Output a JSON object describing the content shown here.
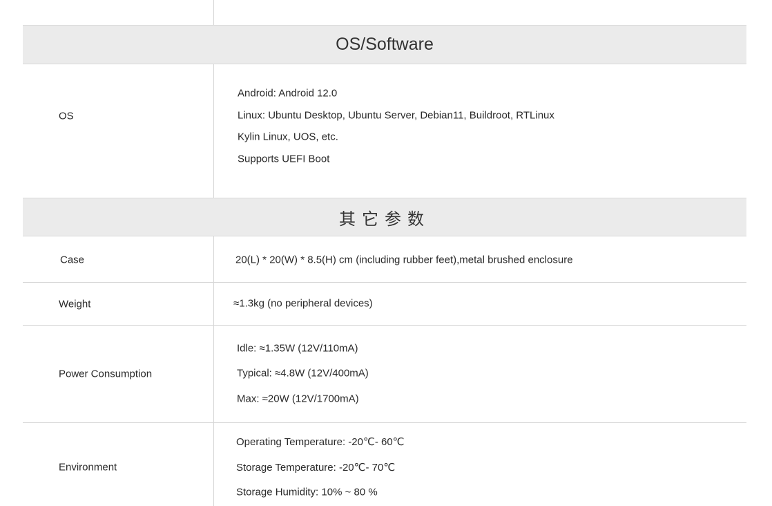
{
  "sections": [
    {
      "title": "OS/Software",
      "rows": [
        {
          "label": "OS",
          "values": [
            "Android: Android 12.0",
            "Linux: Ubuntu Desktop, Ubuntu Server, Debian11, Buildroot, RTLinux",
            "Kylin Linux, UOS, etc.",
            "Supports UEFI Boot"
          ]
        }
      ]
    },
    {
      "title": "其它参数",
      "rows": [
        {
          "label": "Case",
          "values": [
            "20(L) * 20(W) * 8.5(H) cm (including rubber feet),metal brushed enclosure"
          ]
        },
        {
          "label": "Weight",
          "values": [
            "≈1.3kg (no peripheral devices)"
          ]
        },
        {
          "label": "Power Consumption",
          "values": [
            "Idle: ≈1.35W (12V/110mA)",
            "Typical: ≈4.8W (12V/400mA)",
            "Max: ≈20W (12V/1700mA)"
          ]
        },
        {
          "label": "Environment",
          "values": [
            "Operating Temperature: -20℃- 60℃",
            "Storage Temperature: -20℃- 70℃",
            "Storage Humidity: 10% ~ 80 %"
          ]
        }
      ]
    }
  ]
}
